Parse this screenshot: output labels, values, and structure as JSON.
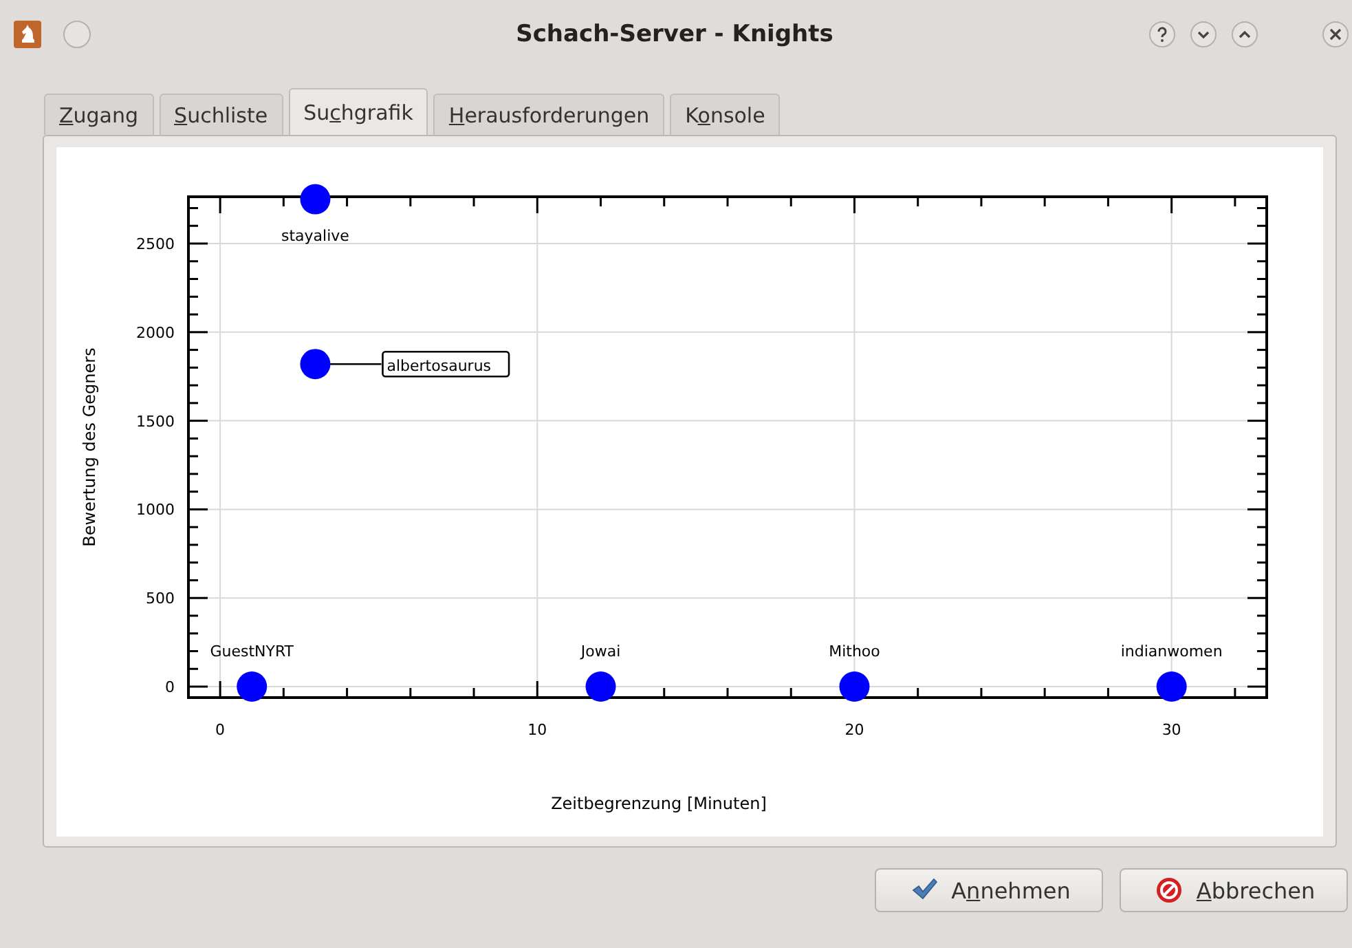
{
  "window": {
    "title": "Schach-Server - Knights"
  },
  "tabs": [
    {
      "key": "Z",
      "after": "ugang",
      "selected": false
    },
    {
      "key": "S",
      "after": "uchliste",
      "selected": false
    },
    {
      "before": "Su",
      "key": "c",
      "after": "hgrafik",
      "selected": true
    },
    {
      "key": "H",
      "after": "erausforderungen",
      "selected": false
    },
    {
      "before": "K",
      "key": "o",
      "after": "nsole",
      "selected": false
    }
  ],
  "chart_data": {
    "type": "scatter",
    "xlabel": "Zeitbegrenzung [Minuten]",
    "ylabel": "Bewertung des Gegners",
    "xlim": [
      -1,
      33
    ],
    "ylim": [
      -62,
      2764
    ],
    "xticks": [
      0,
      10,
      20,
      30
    ],
    "yticks": [
      0,
      500,
      1000,
      1500,
      2000,
      2500
    ],
    "grid": true,
    "x": [
      1,
      3,
      3,
      12,
      20,
      30
    ],
    "series": [
      {
        "color": "#0000ff",
        "values": [
          0,
          2750,
          1820,
          0,
          0,
          0
        ]
      }
    ],
    "annotations": [
      {
        "text": "GuestNYRT",
        "x": 1,
        "y": 0
      },
      {
        "text": "stayalive",
        "x": 3,
        "y": 2750
      },
      {
        "text": "albertosaurus",
        "x": 3,
        "y": 1820
      },
      {
        "text": "Jowai",
        "x": 12,
        "y": 0
      },
      {
        "text": "Mithoo",
        "x": 20,
        "y": 0
      },
      {
        "text": "indianwomen",
        "x": 30,
        "y": 0
      }
    ]
  },
  "buttons": [
    {
      "kind": "accept",
      "before": "A",
      "key": "n",
      "after": "nehmen"
    },
    {
      "kind": "cancel",
      "key": "A",
      "after": "bbrechen"
    }
  ]
}
